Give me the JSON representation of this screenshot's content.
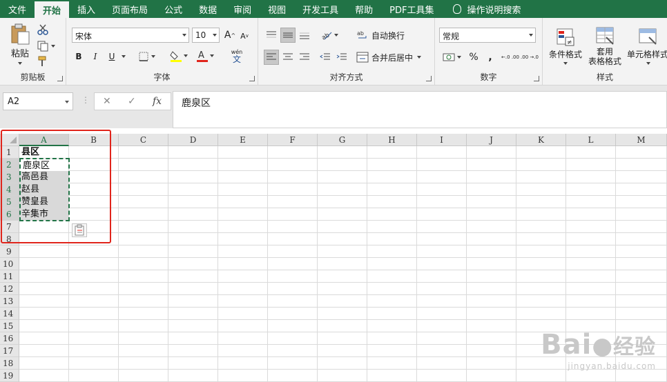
{
  "tabs": [
    "文件",
    "开始",
    "插入",
    "页面布局",
    "公式",
    "数据",
    "审阅",
    "视图",
    "开发工具",
    "帮助",
    "PDF工具集"
  ],
  "active_tab": "开始",
  "tell_me": "操作说明搜索",
  "ribbon": {
    "clipboard": {
      "paste": "粘贴",
      "label": "剪贴板"
    },
    "font": {
      "name": "宋体",
      "size": "10",
      "label": "字体",
      "bold": "B",
      "italic": "I",
      "underline": "U",
      "wen": "wén",
      "wen_char": "文",
      "grow": "A",
      "shrink": "A"
    },
    "alignment": {
      "wrap": "自动换行",
      "merge": "合并后居中",
      "label": "对齐方式"
    },
    "number": {
      "format": "常规",
      "label": "数字",
      "percent": "%",
      "comma": ",",
      "inc": "←.0 .00",
      "dec": ".00 →.0"
    },
    "styles": {
      "conditional": "条件格式",
      "table_format_1": "套用",
      "table_format_2": "表格格式",
      "cell_style": "单元格样式",
      "label": "样式"
    }
  },
  "formula_bar": {
    "name_box": "A2",
    "fx": "fx",
    "cancel": "✕",
    "enter": "✓",
    "value": "鹿泉区"
  },
  "columns": [
    "A",
    "B",
    "C",
    "D",
    "E",
    "F",
    "G",
    "H",
    "I",
    "J",
    "K",
    "L",
    "M"
  ],
  "rows": [
    "1",
    "2",
    "3",
    "4",
    "5",
    "6",
    "7",
    "8",
    "9",
    "10",
    "11",
    "12",
    "13",
    "14",
    "15",
    "16",
    "17",
    "18",
    "19"
  ],
  "cells": {
    "A1": "县区",
    "A2": "鹿泉区",
    "A3": "高邑县",
    "A4": "赵县",
    "A5": "赞皇县",
    "A6": "辛集市"
  },
  "watermark": {
    "brand": "Bai",
    "brand2": "经验",
    "url": "jingyan.baidu.com"
  }
}
